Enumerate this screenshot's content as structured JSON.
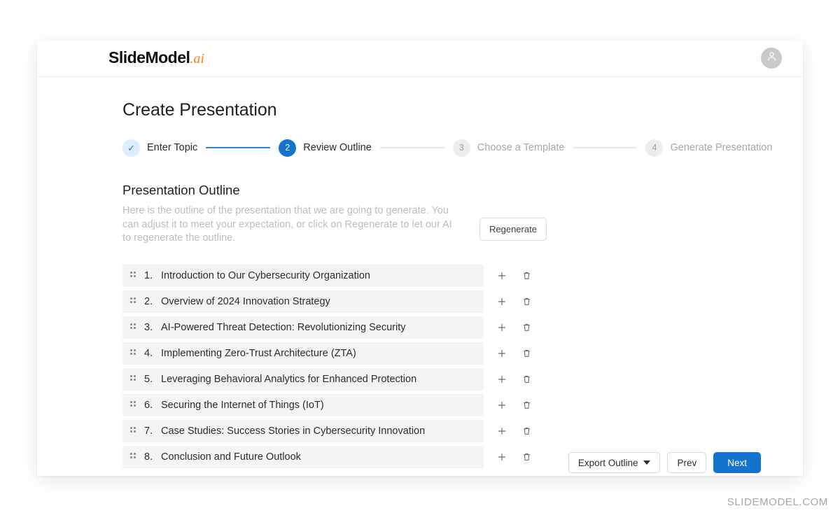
{
  "header": {
    "logo_main": "SlideModel",
    "logo_suffix": ".ai",
    "avatar_icon": "user-avatar-icon"
  },
  "page": {
    "title": "Create Presentation"
  },
  "stepper": {
    "steps": [
      {
        "marker": "✓",
        "label": "Enter Topic",
        "state": "done"
      },
      {
        "marker": "2",
        "label": "Review Outline",
        "state": "active"
      },
      {
        "marker": "3",
        "label": "Choose a Template",
        "state": "idle"
      },
      {
        "marker": "4",
        "label": "Generate Presentation",
        "state": "idle"
      }
    ],
    "connector_colors": [
      "#2f86d6",
      "#e6e6e6",
      "#e6e6e6"
    ]
  },
  "outline": {
    "title": "Presentation Outline",
    "description": "Here is the outline of the presentation that we are going to generate. You can adjust it to meet your expectation, or click on Regenerate to let our AI to regenerate the outline.",
    "regenerate_label": "Regenerate",
    "rows": [
      {
        "num": "1.",
        "text": "Introduction to Our Cybersecurity Organization"
      },
      {
        "num": "2.",
        "text": "Overview of 2024 Innovation Strategy"
      },
      {
        "num": "3.",
        "text": "AI-Powered Threat Detection: Revolutionizing Security"
      },
      {
        "num": "4.",
        "text": "Implementing Zero-Trust Architecture (ZTA)"
      },
      {
        "num": "5.",
        "text": "Leveraging Behavioral Analytics for Enhanced Protection"
      },
      {
        "num": "6.",
        "text": "Securing the Internet of Things (IoT)"
      },
      {
        "num": "7.",
        "text": "Case Studies: Success Stories in Cybersecurity Innovation"
      },
      {
        "num": "8.",
        "text": "Conclusion and Future Outlook"
      }
    ],
    "row_add_icon": "plus-icon",
    "row_delete_icon": "trash-icon",
    "drag_icon": "drag-handle-icon"
  },
  "footer": {
    "export_label": "Export Outline",
    "export_caret_icon": "chevron-down-icon",
    "prev_label": "Prev",
    "next_label": "Next"
  },
  "watermark": "SLIDEMODEL.COM",
  "colors": {
    "primary": "#1473cc",
    "accent_orange": "#f0861c",
    "row_bg": "#f4f4f4",
    "muted_text": "#bdbdbd"
  }
}
